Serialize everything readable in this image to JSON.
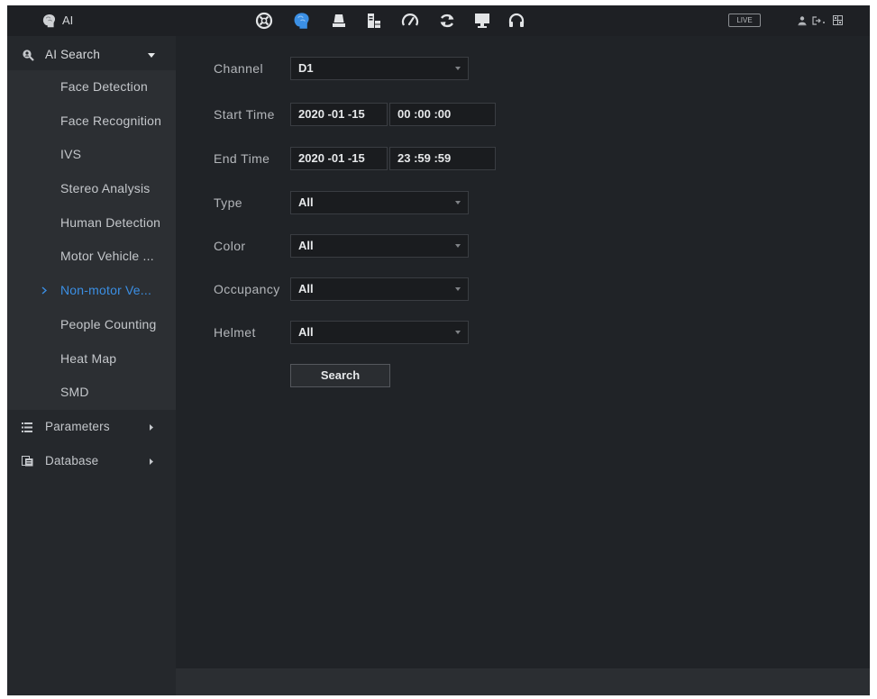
{
  "colors": {
    "accent": "#3b8fe4",
    "background": "#202327",
    "sidebar": "#25282c",
    "submenu": "#2c2f33",
    "topbar": "#1e2024",
    "statusbar": "#2b2e32",
    "label_text": "#b3b6ba",
    "value_text": "#e6e8ea",
    "menu_text": "#c4c7cb",
    "field_bg": "#1a1c1f",
    "field_border": "#3a3d42"
  },
  "topbar": {
    "app_icon": "ai-brain-icon",
    "app_title": "AI",
    "nav_icons": [
      "main-menu-icon",
      "ai-icon",
      "camera-icon",
      "storage-icon",
      "speedometer-icon",
      "refresh-icon",
      "monitor-icon",
      "headset-icon"
    ],
    "active_nav": "ai-icon",
    "live_label": "LIVE",
    "right_icons": [
      "user-icon",
      "logout-icon",
      "grid-icon"
    ]
  },
  "sidebar": {
    "ai_search": {
      "label": "AI Search",
      "icon": "ai-search-icon",
      "expanded": true,
      "items": [
        {
          "label": "Face Detection"
        },
        {
          "label": "Face Recognition"
        },
        {
          "label": "IVS"
        },
        {
          "label": "Stereo Analysis"
        },
        {
          "label": "Human Detection"
        },
        {
          "label": "Motor Vehicle ..."
        },
        {
          "label": "Non-motor Ve...",
          "active": true
        },
        {
          "label": "People Counting"
        },
        {
          "label": "Heat Map"
        },
        {
          "label": "SMD"
        }
      ]
    },
    "parameters": {
      "label": "Parameters",
      "icon": "list-icon"
    },
    "database": {
      "label": "Database",
      "icon": "database-icon"
    }
  },
  "form": {
    "channel": {
      "label": "Channel",
      "value": "D1"
    },
    "start_time": {
      "label": "Start Time",
      "date": "2020 -01 -15",
      "time": "00 :00 :00"
    },
    "end_time": {
      "label": "End Time",
      "date": "2020 -01 -15",
      "time": "23 :59 :59"
    },
    "type": {
      "label": "Type",
      "value": "All"
    },
    "color": {
      "label": "Color",
      "value": "All"
    },
    "occupancy": {
      "label": "Occupancy",
      "value": "All"
    },
    "helmet": {
      "label": "Helmet",
      "value": "All"
    },
    "search_button": "Search"
  }
}
